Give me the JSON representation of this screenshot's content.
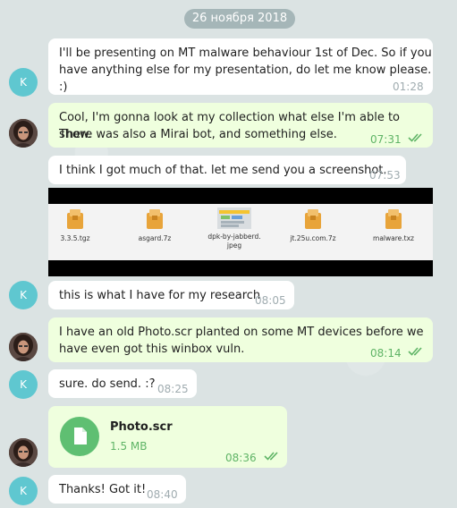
{
  "date_separator": "26 ноября 2018",
  "contact_initial": "K",
  "messages": [
    {
      "line1": "I'll be presenting on MT malware behaviour 1st of Dec. So if you",
      "line2": "have anything else for my presentation, do let me know please. :)",
      "time": "01:28"
    },
    {
      "line1": "Cool, I'm gonna look at my collection what else I'm able to show.",
      "line2": "There was also a Mirai bot, and something else.",
      "time": "07:31"
    },
    {
      "text": "I think I got much of that. let me send you a screenshot.",
      "time": "07:53"
    },
    {
      "text": "this is what I have for my research",
      "time": "08:05"
    },
    {
      "line1": "I have an old Photo.scr planted on some MT devices before we",
      "line2": "have even got this winbox vuln.",
      "time": "08:14"
    },
    {
      "text": "sure. do send. :?",
      "time": "08:25"
    },
    {
      "doc_name": "Photo.scr",
      "doc_size": "1.5 MB",
      "time": "08:36"
    },
    {
      "text": "Thanks! Got it!",
      "time": "08:40"
    }
  ],
  "screenshot_files": [
    {
      "name": "3.3.5.tgz",
      "icon": "folder-icon"
    },
    {
      "name": "asgard.7z",
      "icon": "folder-icon"
    },
    {
      "name_line1": "dpk-by-jabberd.",
      "name_line2": "jpeg",
      "icon": "image-icon"
    },
    {
      "name": "jt.25u.com.7z",
      "icon": "folder-icon"
    },
    {
      "name": "malware.txz",
      "icon": "folder-icon"
    }
  ],
  "colors": {
    "incoming_bubble": "#ffffff",
    "outgoing_bubble": "#efffde",
    "avatar": "#5fc7d0",
    "document_icon": "#5fbf72",
    "read_ticks": "#5fb466"
  }
}
